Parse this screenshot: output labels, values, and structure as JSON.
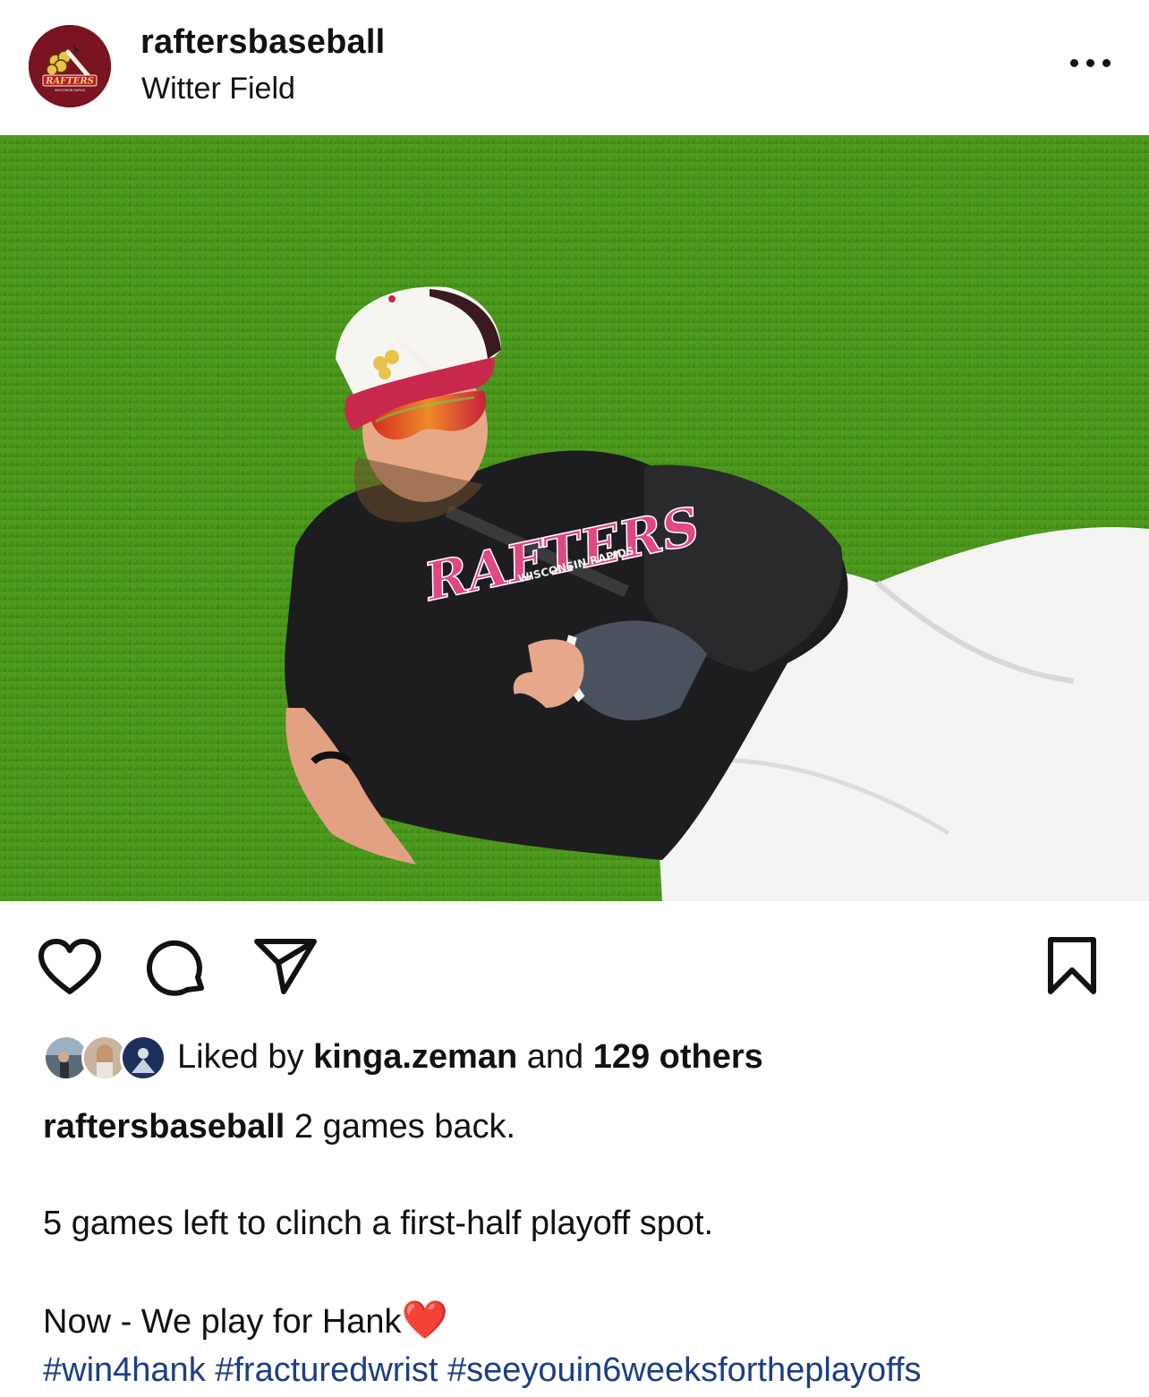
{
  "post": {
    "username": "raftersbaseball",
    "location": "Witter Field"
  },
  "avatar": {
    "logo_text": "RAFTERS",
    "logo_subtext": "WISCONSIN RAPIDS"
  },
  "photo": {
    "shirt_text": "RAFTERS",
    "shirt_subtext": "WISCONSIN RAPIDS"
  },
  "icons": {
    "more": "more-options-icon",
    "like": "heart-icon",
    "comment": "comment-icon",
    "share": "send-icon",
    "save": "bookmark-icon"
  },
  "likes": {
    "prefix": "Liked by ",
    "user": "kinga.zeman",
    "middle": " and ",
    "others": "129 others"
  },
  "caption": {
    "username": "raftersbaseball",
    "line1": " 2 games back.",
    "line2": "5 games left to clinch a first-half playoff spot.",
    "line3": "Now - We play for Hank",
    "emoji": "❤️",
    "hashtags": "#win4hank #fracturedwrist #seeyouin6weeksfortheplayoffs"
  },
  "colors": {
    "brand_maroon": "#7a1420",
    "grass": "#4f9a1e",
    "hashtag_blue": "#1b3e86"
  }
}
